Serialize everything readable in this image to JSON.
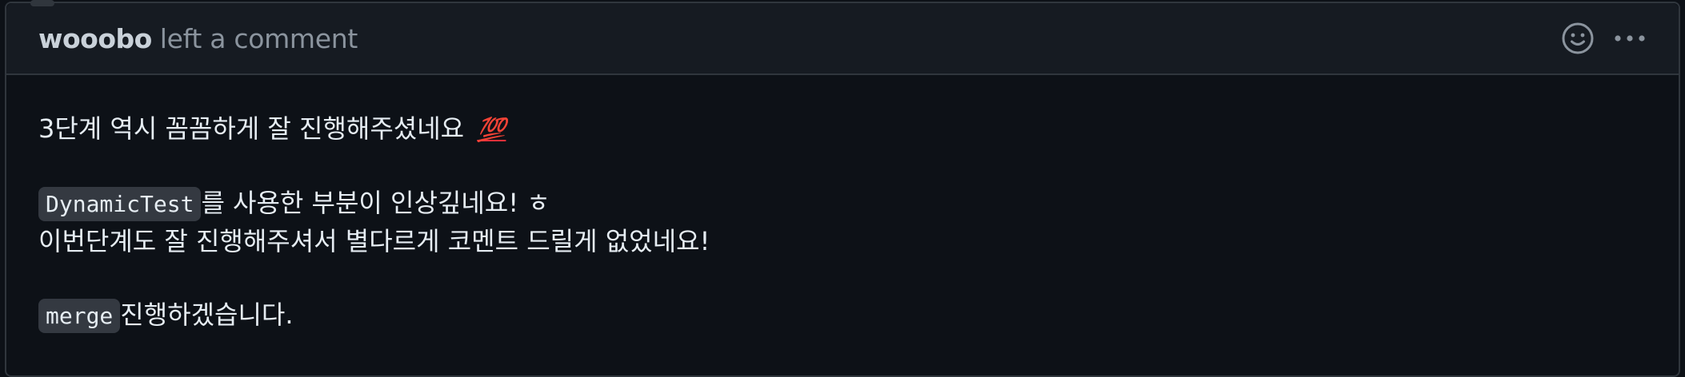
{
  "comment": {
    "author": "wooobo",
    "action_text": "left a comment",
    "header_icons": [
      "smiley-icon",
      "kebab-menu-icon"
    ]
  },
  "body": {
    "line1_text": "3단계 역시 꼼꼼하게 잘 진행해주셨네요",
    "line1_emoji": "💯",
    "line2_code": "DynamicTest",
    "line2_text": "를 사용한 부분이 인상깊네요! ㅎ",
    "line3_text": "이번단계도 잘 진행해주셔서 별다르게 코멘트 드릴게 없었네요!",
    "line4_code": "merge",
    "line4_text": "진행하겠습니다."
  },
  "colors": {
    "background": "#0d1117",
    "header_background": "#161b22",
    "border": "#30363d",
    "text": "#e6edf3",
    "muted_text": "#8b949e",
    "code_background": "#343941",
    "emoji_red": "#f0303a"
  }
}
